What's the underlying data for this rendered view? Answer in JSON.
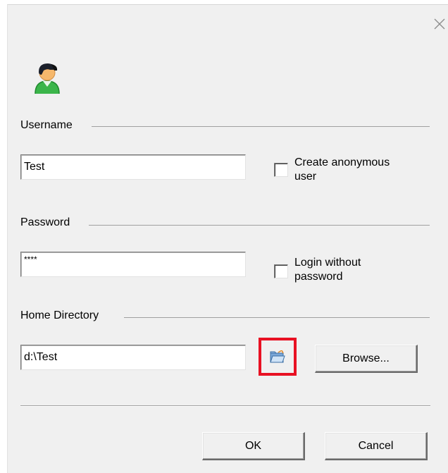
{
  "dialog": {
    "close_icon": "close-icon",
    "user_icon": "user-icon"
  },
  "username": {
    "label": "Username",
    "value": "Test",
    "anonymous_checkbox": {
      "label_line1": "Create anonymous",
      "label_line2": "user",
      "checked": false
    }
  },
  "password": {
    "label": "Password",
    "value": "****",
    "no_password_checkbox": {
      "label_line1": "Login without",
      "label_line2": "password",
      "checked": false
    }
  },
  "home_directory": {
    "label": "Home Directory",
    "value": "d:\\Test",
    "folder_icon": "folder-open-icon",
    "browse_label": "Browse..."
  },
  "buttons": {
    "ok_label": "OK",
    "cancel_label": "Cancel"
  },
  "colors": {
    "dialog_bg": "#f0f0f0",
    "highlight_border": "#e81123"
  }
}
